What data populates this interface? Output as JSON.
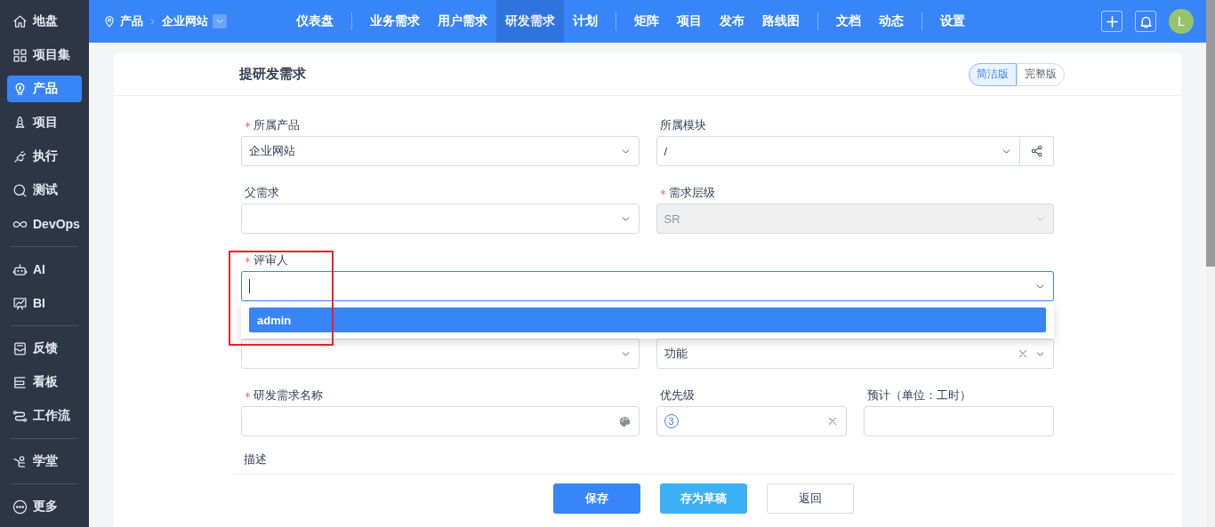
{
  "sidebar": {
    "groups": [
      [
        {
          "label": "地盘",
          "selected": false
        },
        {
          "label": "项目集",
          "selected": false
        },
        {
          "label": "产品",
          "selected": true
        },
        {
          "label": "项目",
          "selected": false
        },
        {
          "label": "执行",
          "selected": false
        },
        {
          "label": "测试",
          "selected": false
        },
        {
          "label": "DevOps",
          "selected": false
        }
      ],
      [
        {
          "label": "AI",
          "selected": false
        },
        {
          "label": "BI",
          "selected": false
        }
      ],
      [
        {
          "label": "反馈",
          "selected": false
        },
        {
          "label": "看板",
          "selected": false
        },
        {
          "label": "工作流",
          "selected": false
        }
      ],
      [
        {
          "label": "学堂",
          "selected": false
        }
      ],
      [
        {
          "label": "更多",
          "selected": false
        }
      ]
    ]
  },
  "topbar": {
    "breadcrumb": {
      "root": "产品",
      "current": "企业网站"
    },
    "nav_groups": [
      [
        {
          "label": "仪表盘",
          "selected": false
        }
      ],
      [
        {
          "label": "业务需求",
          "selected": false
        },
        {
          "label": "用户需求",
          "selected": false
        },
        {
          "label": "研发需求",
          "selected": true
        },
        {
          "label": "计划",
          "selected": false
        }
      ],
      [
        {
          "label": "矩阵",
          "selected": false
        },
        {
          "label": "项目",
          "selected": false
        },
        {
          "label": "发布",
          "selected": false
        },
        {
          "label": "路线图",
          "selected": false
        }
      ],
      [
        {
          "label": "文档",
          "selected": false
        },
        {
          "label": "动态",
          "selected": false
        }
      ],
      [
        {
          "label": "设置",
          "selected": false
        }
      ]
    ],
    "avatar": "L"
  },
  "form": {
    "title": "提研发需求",
    "modes": [
      {
        "label": "简洁版",
        "selected": true
      },
      {
        "label": "完整版",
        "selected": false
      }
    ],
    "rows": [
      [
        {
          "label": "所属产品",
          "required": true,
          "kind": "select",
          "value": "企业网站"
        },
        {
          "label": "所属模块",
          "required": false,
          "kind": "select_addon",
          "value": "/"
        }
      ],
      [
        {
          "label": "父需求",
          "required": false,
          "kind": "select"
        },
        {
          "label": "需求层级",
          "required": true,
          "kind": "select",
          "value": "SR",
          "disabled": true
        }
      ],
      [
        {
          "label": "评审人",
          "required": true,
          "kind": "select",
          "focused": true,
          "options": [
            {
              "label": "admin",
              "selected": true
            }
          ]
        }
      ],
      [
        {
          "kind": "select"
        },
        {
          "kind": "select",
          "value": "功能",
          "clearable": true
        }
      ],
      [
        {
          "label": "研发需求名称",
          "required": true,
          "kind": "input_palette"
        },
        {
          "label": "优先级",
          "required": false,
          "kind": "priority",
          "value": "3",
          "clearable": true
        },
        {
          "label": "预计（单位：工时）",
          "required": false,
          "kind": "input"
        }
      ]
    ],
    "description_label": "描述",
    "buttons": [
      {
        "label": "保存",
        "kind": "primary"
      },
      {
        "label": "存为草稿",
        "kind": "secondary"
      },
      {
        "label": "返回",
        "kind": "default"
      }
    ]
  }
}
